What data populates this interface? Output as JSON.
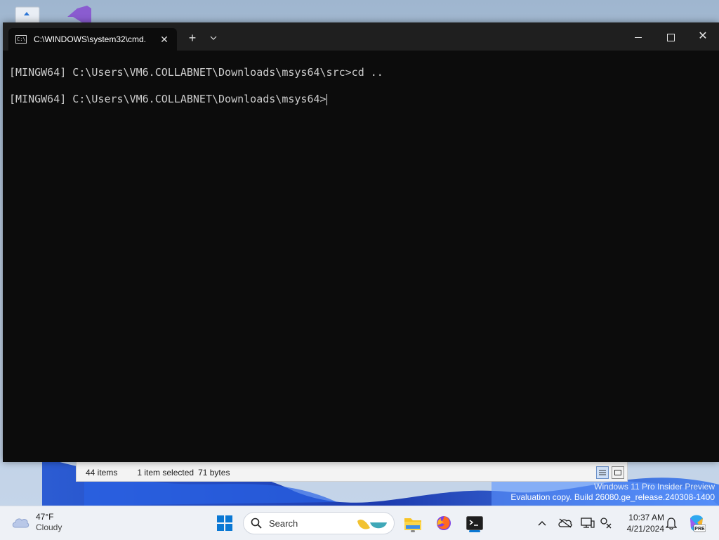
{
  "terminal": {
    "tab_title": "C:\\WINDOWS\\system32\\cmd.",
    "tab_icon_text": "C:\\",
    "new_tab_symbol": "+",
    "dropdown_symbol": "⌄",
    "close_symbol": "✕",
    "lines": [
      "[MINGW64] C:\\Users\\VM6.COLLABNET\\Downloads\\msys64\\src>cd ..",
      "[MINGW64] C:\\Users\\VM6.COLLABNET\\Downloads\\msys64>"
    ]
  },
  "explorer": {
    "item_count": "44 items",
    "selection": "1 item selected",
    "selection_size": "71 bytes"
  },
  "watermark": {
    "line1": "Windows 11 Pro Insider Preview",
    "line2": "Evaluation copy. Build 26080.ge_release.240308-1400"
  },
  "taskbar": {
    "weather_temp": "47°F",
    "weather_condition": "Cloudy",
    "search_placeholder": "Search",
    "time": "10:37 AM",
    "date": "4/21/2024",
    "copilot_badge": "PRE"
  },
  "colors": {
    "terminal_bg": "#0c0c0c",
    "titlebar_bg": "#1f1f1f",
    "accent": "#0a78d4",
    "taskbar_bg": "#eef1f6"
  },
  "icons": [
    "recycle-bin-icon",
    "visual-studio-icon",
    "cmd-icon",
    "windows-start-icon",
    "search-icon",
    "file-explorer-icon",
    "firefox-icon",
    "terminal-icon",
    "chevron-up-icon",
    "cloud-off-icon",
    "display-icon",
    "network-icon",
    "bell-icon",
    "copilot-icon"
  ]
}
